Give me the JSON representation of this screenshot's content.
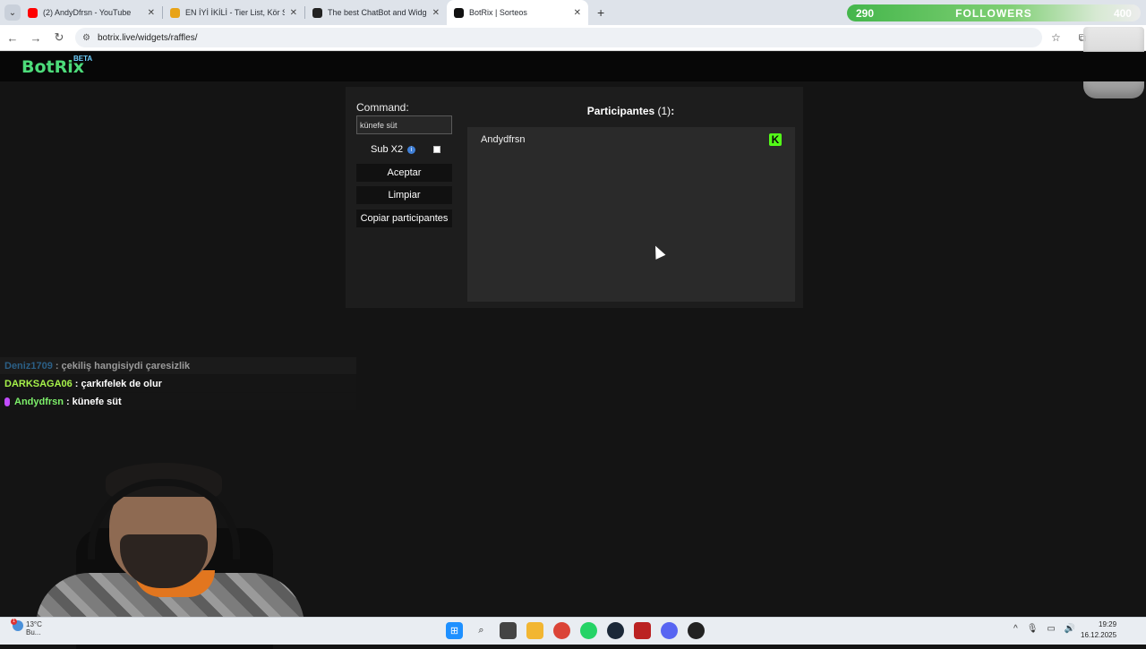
{
  "browser": {
    "tabs": [
      {
        "title": "(2) AndyDfrsn - YouTube",
        "favicon_color": "#ff0000",
        "active": false
      },
      {
        "title": "EN İYİ İKİLİ - Tier List, Kör Sırala",
        "favicon_color": "#e8a317",
        "active": false
      },
      {
        "title": "The best ChatBot and Widgets",
        "favicon_color": "#222222",
        "active": false
      },
      {
        "title": "BotRix | Sorteos",
        "favicon_color": "#111111",
        "active": true
      }
    ],
    "new_tab": "+",
    "url": "botrix.live/widgets/raffles/"
  },
  "followers_goal": {
    "current": "290",
    "label": "FOLLOWERS",
    "target": "400"
  },
  "botrix": {
    "logo": "BotRix",
    "badge": "BETA",
    "command_label": "Command:",
    "command_value": "künefe süt",
    "sub_label": "Sub X2",
    "sub_checked": false,
    "buttons": {
      "accept": "Aceptar",
      "clear": "Limpiar",
      "copy": "Copiar participantes"
    },
    "participants_title": "Participantes",
    "participants_count": "(1)",
    "participants_colon": ":",
    "participants": [
      {
        "name": "Andydfrsn",
        "platform_icon": "kick-icon"
      }
    ]
  },
  "chat": [
    {
      "user": "Deniz1709",
      "user_color": "#2b5f86",
      "message": "çekiliş hangisiydi çaresizlik",
      "faded": true
    },
    {
      "user": "DARKSAGA06",
      "user_color": "#a6f24a",
      "message": "çarkıfelek de olur",
      "faded": false
    },
    {
      "user": "Andydfrsn",
      "user_color": "#7df06a",
      "message": "künefe süt",
      "faded": false
    }
  ],
  "taskbar": {
    "weather_temp": "13°C",
    "weather_desc": "Bu...",
    "weather_badge": "1",
    "time": "19:29",
    "date": "16.12.2025"
  }
}
